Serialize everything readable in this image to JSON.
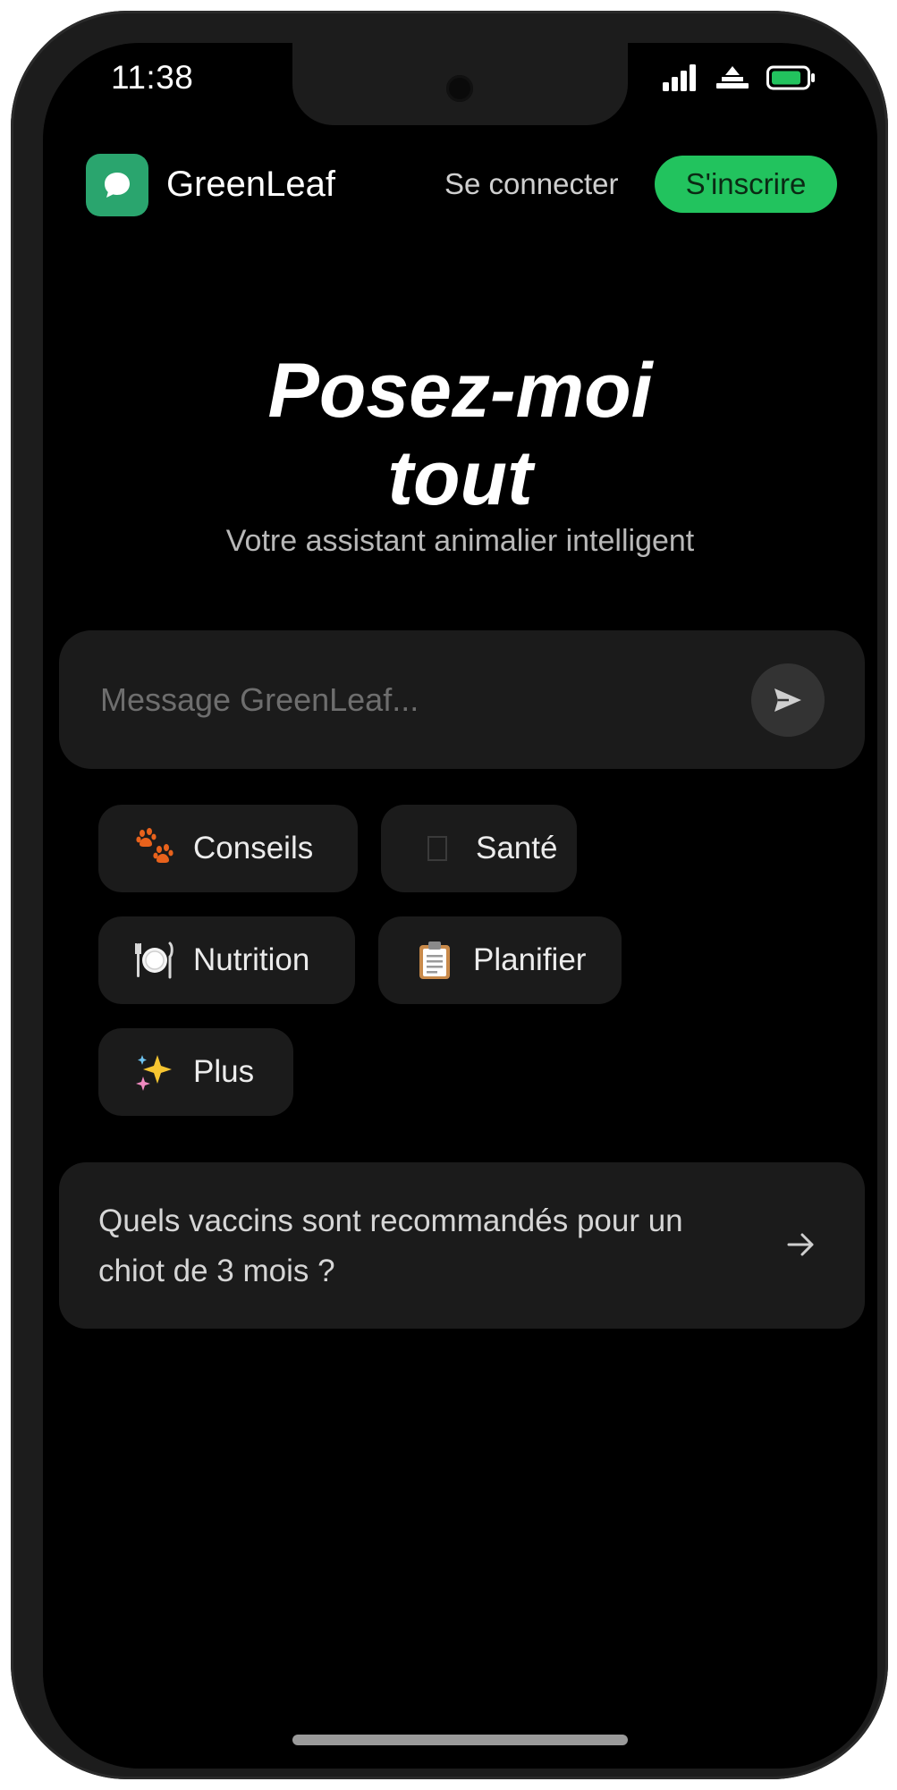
{
  "status_bar": {
    "time": "11:38"
  },
  "header": {
    "app_name": "GreenLeaf",
    "logo_icon": "chat-bubble-icon",
    "login_label": "Se connecter",
    "signup_label": "S'inscrire"
  },
  "hero": {
    "title_line1": "Posez-moi",
    "title_line2": "tout",
    "subtitle": "Votre assistant animalier intelligent"
  },
  "composer": {
    "placeholder": "Message GreenLeaf...",
    "value": "",
    "send_icon": "send-icon"
  },
  "chips": [
    {
      "label": "Conseils",
      "icon": "paw-prints-icon"
    },
    {
      "label": "Santé",
      "icon": "missing-glyph-icon"
    },
    {
      "label": "Nutrition",
      "icon": "plate-cutlery-icon"
    },
    {
      "label": "Planifier",
      "icon": "clipboard-icon"
    },
    {
      "label": "Plus",
      "icon": "sparkles-icon"
    }
  ],
  "suggestion": {
    "text": "Quels vaccins sont recommandés pour un chiot de 3 mois ?",
    "icon": "arrow-right-icon"
  },
  "colors": {
    "brand_green": "#2aa56e",
    "signup_green": "#22c35e",
    "background": "#000000",
    "card": "#1b1b1b"
  }
}
